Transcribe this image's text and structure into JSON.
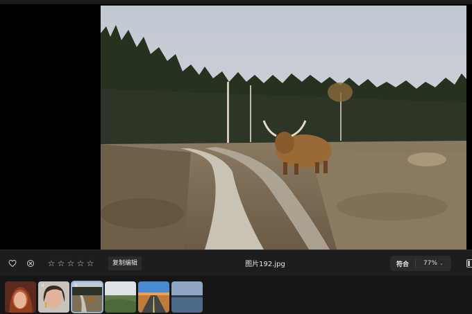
{
  "toolbar": {
    "heart_icon": "heart-icon",
    "reject_icon": "reject-icon",
    "star_glyph": "☆",
    "rating_max": 5,
    "rating_value": 0,
    "copy_edits_label": "复制编辑",
    "filename": "图片192.jpg",
    "fit_label": "符合",
    "zoom_level": "77%"
  },
  "filmstrip": {
    "thumbnails": [
      {
        "subject": "woman-portrait-red-hair",
        "selected": false,
        "has_badge": false
      },
      {
        "subject": "woman-portrait-earrings",
        "selected": false,
        "has_badge": true
      },
      {
        "subject": "highland-cow-heath",
        "selected": true,
        "has_badge": true
      },
      {
        "subject": "coastal-landscape",
        "selected": false,
        "has_badge": false
      },
      {
        "subject": "desert-road",
        "selected": false,
        "has_badge": false
      },
      {
        "subject": "calm-lake-horizon",
        "selected": false,
        "has_badge": false
      }
    ]
  },
  "colors": {
    "toolbar_bg": "#1d1d1f",
    "selection_outline": "#8fb3d9",
    "sky": "#c9ced6"
  }
}
